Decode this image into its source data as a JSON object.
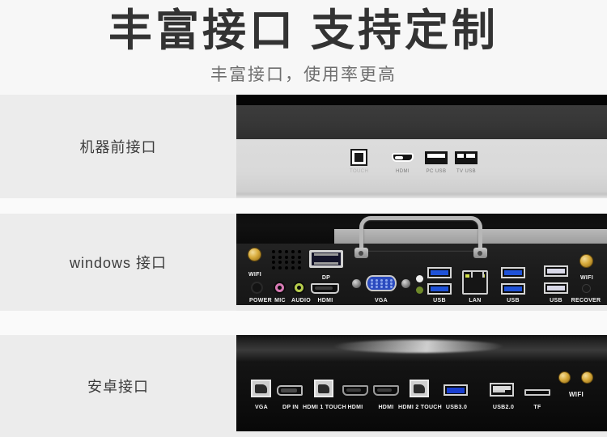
{
  "header": {
    "title_part1": "丰富接口",
    "title_part2": "支持定制",
    "subtitle": "丰富接口，使用率更高"
  },
  "colors": {
    "page_bg": "#fafafa",
    "header_bg": "#f7f7f7",
    "section_bg": "#ececec",
    "title_color": "#333333",
    "subtitle_color": "#6e6e6e",
    "label_color": "#3c3c3c",
    "usb3_blue": "#1f52d8",
    "vga_blue": "#2b4bbf",
    "mic_pink": "#d77ab4",
    "audio_green": "#b6cc4c",
    "antenna_gold": "#d8ab3c"
  },
  "sections": [
    {
      "id": "front",
      "label": "机器前接口",
      "ports": [
        {
          "name": "TOUCH",
          "icon": "touch-port-icon",
          "dim": true
        },
        {
          "name": "HDMI",
          "icon": "hdmi-port-icon",
          "dim": false
        },
        {
          "name": "PC USB",
          "icon": "usb-port-icon",
          "dim": false
        },
        {
          "name": "TV USB",
          "icon": "usb-port-icon",
          "dim": false
        }
      ]
    },
    {
      "id": "windows",
      "label": "windows 接口",
      "ports": [
        {
          "name": "WIFI",
          "icon": "wifi-antenna-icon"
        },
        {
          "name": "POWER",
          "icon": "power-jack-icon"
        },
        {
          "name": "MIC",
          "icon": "mic-jack-icon"
        },
        {
          "name": "AUDIO",
          "icon": "audio-jack-icon"
        },
        {
          "name": "DP",
          "icon": "displayport-icon"
        },
        {
          "name": "HDMI",
          "icon": "hdmi-port-icon"
        },
        {
          "name": "VGA",
          "icon": "vga-port-icon"
        },
        {
          "name": "USB",
          "icon": "usb3-port-icon"
        },
        {
          "name": "LAN",
          "icon": "lan-port-icon"
        },
        {
          "name": "USB",
          "icon": "usb3-port-icon"
        },
        {
          "name": "USB",
          "icon": "usb2-port-icon"
        },
        {
          "name": "RECOVER",
          "icon": "recover-button-icon"
        },
        {
          "name": "WIFI",
          "icon": "wifi-antenna-icon"
        }
      ]
    },
    {
      "id": "android",
      "label": "安卓接口",
      "ports": [
        {
          "name": "VGA",
          "icon": "vga-port-icon"
        },
        {
          "name": "DP IN",
          "icon": "displayport-in-icon"
        },
        {
          "name": "HDMI 1 TOUCH",
          "icon": "hdmi-touch-port-icon"
        },
        {
          "name": "HDMI",
          "icon": "hdmi-port-icon"
        },
        {
          "name": "HDMI",
          "icon": "hdmi-port-icon"
        },
        {
          "name": "HDMI 2 TOUCH",
          "icon": "hdmi-touch-port-icon"
        },
        {
          "name": "USB3.0",
          "icon": "usb3-port-icon"
        },
        {
          "name": "USB2.0",
          "icon": "usb2-port-icon"
        },
        {
          "name": "TF",
          "icon": "tf-card-slot-icon"
        },
        {
          "name": "WIFI",
          "icon": "wifi-antenna-icon"
        }
      ]
    }
  ]
}
